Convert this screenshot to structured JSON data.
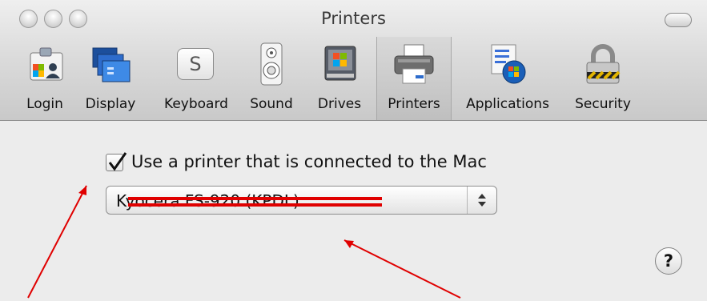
{
  "window": {
    "title": "Printers"
  },
  "toolbar": {
    "items": [
      {
        "label": "Login",
        "icon": "login-icon"
      },
      {
        "label": "Display",
        "icon": "display-icon"
      },
      {
        "label": "Keyboard",
        "icon": "keyboard-icon"
      },
      {
        "label": "Sound",
        "icon": "sound-icon"
      },
      {
        "label": "Drives",
        "icon": "drives-icon"
      },
      {
        "label": "Printers",
        "icon": "printer-icon",
        "selected": true
      },
      {
        "label": "Applications",
        "icon": "applications-icon"
      },
      {
        "label": "Security",
        "icon": "lock-icon"
      }
    ],
    "keyboard_key_glyph": "S"
  },
  "printer_section": {
    "checkbox_label": "Use a printer that is connected to the Mac",
    "checkbox_checked": true,
    "selected_printer": "Kyocera FS-920 (KPDL)"
  },
  "help": {
    "glyph": "?"
  },
  "colors": {
    "redaction": "#e00000",
    "annotation_arrow": "#e00000"
  }
}
